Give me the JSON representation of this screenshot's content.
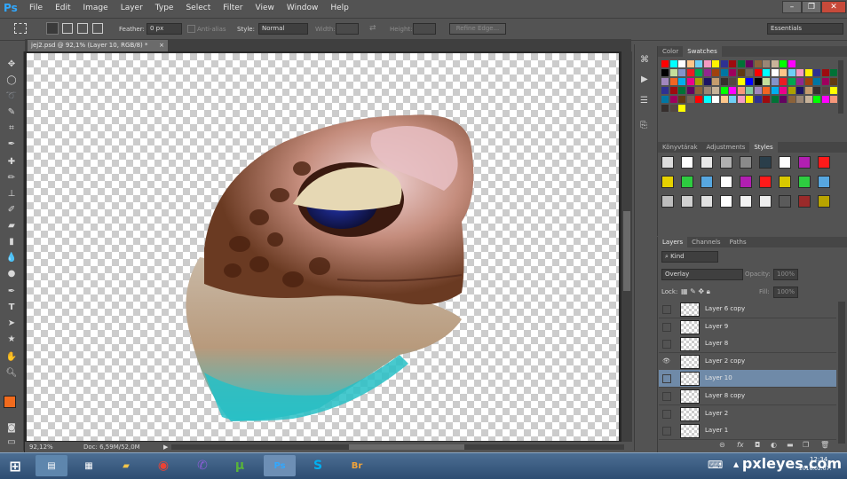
{
  "app": {
    "logo": "Ps"
  },
  "menu": {
    "items": [
      "File",
      "Edit",
      "Image",
      "Layer",
      "Type",
      "Select",
      "Filter",
      "View",
      "Window",
      "Help"
    ]
  },
  "window_controls": {
    "minimize": "–",
    "restore": "❐",
    "close": "✕"
  },
  "options": {
    "feather_label": "Feather:",
    "feather_value": "0 px",
    "antialias_label": "Anti-alias",
    "style_label": "Style:",
    "style_value": "Normal",
    "width_label": "Width:",
    "height_label": "Height:",
    "refine_edge": "Refine Edge...",
    "workspace": "Essentials"
  },
  "document": {
    "tab_title": "jej2.psd @ 92,1% (Layer 10, RGB/8) *",
    "close": "×"
  },
  "status": {
    "zoom": "92,12%",
    "doc_info": "Doc: 6,59M/52,0M"
  },
  "color_panel": {
    "tabs": [
      "Color",
      "Swatches"
    ],
    "active": "Swatches"
  },
  "styles_panel": {
    "tabs": [
      "Könyvtárak",
      "Adjustments",
      "Styles"
    ],
    "active": "Styles"
  },
  "layers_panel": {
    "tabs": [
      "Layers",
      "Channels",
      "Paths"
    ],
    "active": "Layers",
    "filter": "Kind",
    "blend_mode": "Overlay",
    "opacity_label": "Opacity:",
    "opacity_value": "100%",
    "lock_label": "Lock:",
    "fill_label": "Fill:",
    "fill_value": "100%",
    "layers": [
      {
        "name": "Layer 6 copy",
        "visible": false,
        "selected": false
      },
      {
        "name": "Layer 9",
        "visible": false,
        "selected": false
      },
      {
        "name": "Layer 8",
        "visible": false,
        "selected": false
      },
      {
        "name": "Layer 2 copy",
        "visible": true,
        "selected": false
      },
      {
        "name": "Layer 10",
        "visible": false,
        "selected": true
      },
      {
        "name": "Layer 8 copy",
        "visible": false,
        "selected": false
      },
      {
        "name": "Layer 2",
        "visible": false,
        "selected": false
      },
      {
        "name": "Layer 1",
        "visible": false,
        "selected": false
      }
    ],
    "footer_icons": [
      "link-icon",
      "fx-icon",
      "mask-icon",
      "adjustment-icon",
      "folder-icon",
      "new-layer-icon",
      "trash-icon"
    ]
  },
  "foreground_color": "#f26b1d",
  "background_color": "#ffffff",
  "taskbar": {
    "clock": "12:34",
    "date": "2016.02.07.",
    "apps": [
      "file-explorer",
      "calculator",
      "chrome",
      "viber",
      "utorrent",
      "photoshop",
      "skype",
      "bridge"
    ]
  },
  "watermark": "pxleyes.com"
}
